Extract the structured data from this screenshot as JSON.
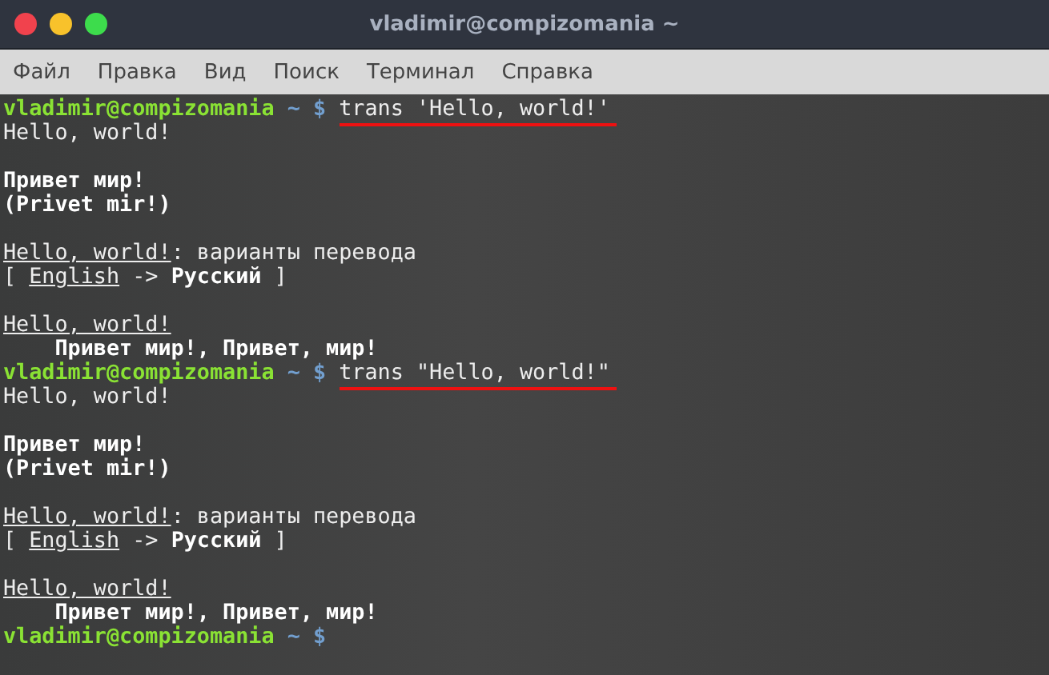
{
  "window": {
    "title": "vladimir@compizomania ~"
  },
  "menu": [
    "Файл",
    "Правка",
    "Вид",
    "Поиск",
    "Терминал",
    "Справка"
  ],
  "lines": [
    {
      "kind": "prompt",
      "user": "vladimir@compizomania",
      "path": " ~ $ ",
      "command": "trans 'Hello, world!'",
      "marked": true
    },
    {
      "kind": "output",
      "segments": [
        {
          "text": "Hello, world!",
          "kind": "plain"
        }
      ]
    },
    {
      "kind": "blank"
    },
    {
      "kind": "output",
      "segments": [
        {
          "text": "Привет мир!",
          "kind": "bold"
        }
      ]
    },
    {
      "kind": "output",
      "segments": [
        {
          "text": "(Privet mir!)",
          "kind": "bold"
        }
      ]
    },
    {
      "kind": "blank"
    },
    {
      "kind": "output",
      "segments": [
        {
          "text": "Hello, world!",
          "kind": "underline"
        },
        {
          "text": ": варианты перевода",
          "kind": "plain"
        }
      ]
    },
    {
      "kind": "output",
      "segments": [
        {
          "text": "[ ",
          "kind": "plain"
        },
        {
          "text": "English",
          "kind": "underline"
        },
        {
          "text": " -> ",
          "kind": "plain"
        },
        {
          "text": "Русский",
          "kind": "bold"
        },
        {
          "text": " ]",
          "kind": "plain"
        }
      ]
    },
    {
      "kind": "blank"
    },
    {
      "kind": "output",
      "segments": [
        {
          "text": "Hello, world!",
          "kind": "underline"
        }
      ]
    },
    {
      "kind": "output",
      "segments": [
        {
          "text": "    Привет мир!, Привет, мир!",
          "kind": "bold"
        }
      ]
    },
    {
      "kind": "prompt",
      "user": "vladimir@compizomania",
      "path": " ~ $ ",
      "command": "trans \"Hello, world!\"",
      "marked": true
    },
    {
      "kind": "output",
      "segments": [
        {
          "text": "Hello, world!",
          "kind": "plain"
        }
      ]
    },
    {
      "kind": "blank"
    },
    {
      "kind": "output",
      "segments": [
        {
          "text": "Привет мир!",
          "kind": "bold"
        }
      ]
    },
    {
      "kind": "output",
      "segments": [
        {
          "text": "(Privet mir!)",
          "kind": "bold"
        }
      ]
    },
    {
      "kind": "blank"
    },
    {
      "kind": "output",
      "segments": [
        {
          "text": "Hello, world!",
          "kind": "underline"
        },
        {
          "text": ": варианты перевода",
          "kind": "plain"
        }
      ]
    },
    {
      "kind": "output",
      "segments": [
        {
          "text": "[ ",
          "kind": "plain"
        },
        {
          "text": "English",
          "kind": "underline"
        },
        {
          "text": " -> ",
          "kind": "plain"
        },
        {
          "text": "Русский",
          "kind": "bold"
        },
        {
          "text": " ]",
          "kind": "plain"
        }
      ]
    },
    {
      "kind": "blank"
    },
    {
      "kind": "output",
      "segments": [
        {
          "text": "Hello, world!",
          "kind": "underline"
        }
      ]
    },
    {
      "kind": "output",
      "segments": [
        {
          "text": "    Привет мир!, Привет, мир!",
          "kind": "bold"
        }
      ]
    },
    {
      "kind": "prompt",
      "user": "vladimir@compizomania",
      "path": " ~ $"
    }
  ]
}
